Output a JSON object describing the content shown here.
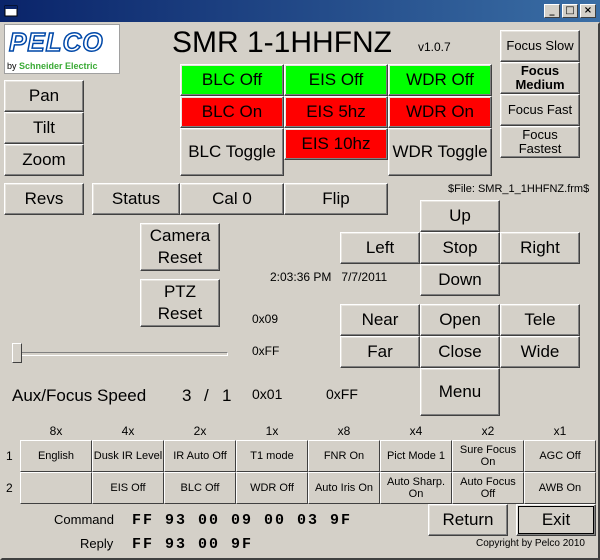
{
  "window": {
    "title": "",
    "minimize": "_",
    "maximize": "□",
    "close": "×"
  },
  "logo": {
    "brand": "PELCO",
    "by": "by",
    "company": "Schneider Electric"
  },
  "header": {
    "model": "SMR 1-1HHFNZ",
    "version": "v1.0.7"
  },
  "file_label": "$File: SMR_1_1HHFNZ.frm$",
  "timestamp": {
    "time": "2:03:36 PM",
    "date": "7/7/2011"
  },
  "buttons": {
    "pan": "Pan",
    "tilt": "Tilt",
    "zoom": "Zoom",
    "blc_off": "BLC Off",
    "blc_on": "BLC On",
    "blc_toggle": "BLC Toggle",
    "eis_off": "EIS Off",
    "eis_5hz": "EIS 5hz",
    "eis_10hz": "EIS 10hz",
    "wdr_off": "WDR Off",
    "wdr_on": "WDR On",
    "wdr_toggle": "WDR Toggle",
    "focus_slow": "Focus Slow",
    "focus_medium": "Focus Medium",
    "focus_fast": "Focus Fast",
    "focus_fastest": "Focus Fastest",
    "revs": "Revs",
    "status": "Status",
    "cal0": "Cal 0",
    "flip": "Flip",
    "camera_reset": "Camera Reset",
    "ptz_reset": "PTZ Reset",
    "up": "Up",
    "left": "Left",
    "stop": "Stop",
    "right": "Right",
    "down": "Down",
    "near": "Near",
    "open": "Open",
    "tele": "Tele",
    "far": "Far",
    "close": "Close",
    "wide": "Wide",
    "menu": "Menu",
    "return": "Return",
    "exit": "Exit"
  },
  "hex": {
    "h09": "0x09",
    "hff": "0xFF",
    "h01": "0x01",
    "hff2": "0xFF"
  },
  "aux": {
    "label": "Aux/Focus Speed",
    "value1": "3",
    "sep": "/",
    "value2": "1"
  },
  "slider": {
    "value": 0
  },
  "grid": {
    "columns": [
      "8x",
      "4x",
      "2x",
      "1x",
      "x8",
      "x4",
      "x2",
      "x1"
    ],
    "rows": [
      "1",
      "2"
    ],
    "row1": [
      "English",
      "Dusk IR Level",
      "IR Auto Off",
      "T1 mode",
      "FNR On",
      "Pict Mode 1",
      "Sure Focus On",
      "AGC Off"
    ],
    "row2": [
      "",
      "EIS Off",
      "BLC Off",
      "WDR Off",
      "Auto Iris On",
      "Auto Sharp. On",
      "Auto Focus Off",
      "AWB On"
    ]
  },
  "command": {
    "label": "Command",
    "value": "FF 93 00 09 00 03 9F"
  },
  "reply": {
    "label": "Reply",
    "value": "FF 93 00 9F"
  },
  "copyright": "Copyright by Pelco 2010",
  "colors": {
    "green": "#00ff00",
    "red": "#ff0000",
    "face": "#d4d0c8",
    "titlebar": "#0a246a"
  }
}
